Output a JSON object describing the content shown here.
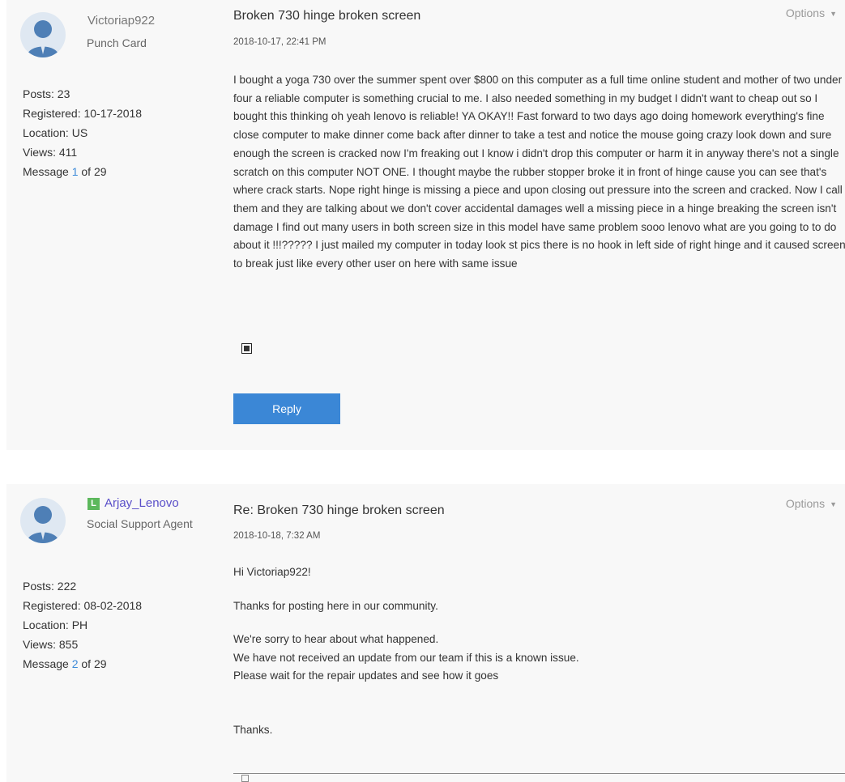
{
  "posts": [
    {
      "author": "Victoriap922",
      "role": "Punch Card",
      "stats": {
        "posts_label": "Posts:",
        "posts": "23",
        "registered_label": "Registered:",
        "registered": "10-17-2018",
        "location_label": "Location:",
        "location": "US",
        "views_label": "Views:",
        "views": "411",
        "message_prefix": "Message",
        "message_num": "1",
        "message_suffix": "of 29"
      },
      "title": "Broken 730 hinge broken screen",
      "date": "2018-10-17, 22:41 PM",
      "options_label": "Options",
      "body": [
        "I bought a yoga 730 over the summer spent over $800 on this computer as a full time online student and mother of two under four a reliable computer is something crucial to me. I also needed something in my budget I didn't want to cheap out so I bought this thinking oh yeah lenovo is reliable! YA OKAY!! Fast forward to two days ago doing homework everything's fine close computer to make dinner come back after dinner to take a test and notice the mouse going crazy look down and sure enough the screen is cracked now I'm freaking out I know i didn't drop this computer or harm it in anyway there's not a single scratch on this computer NOT ONE. I thought maybe the rubber stopper broke it in front of hinge cause you can see that's where crack starts. Nope right hinge is missing a piece and upon closing out pressure into the screen and cracked. Now I call them and they are talking about we don't cover accidental damages well a missing piece in a hinge breaking the screen isn't damage I find out many users in both screen size in this model have same problem sooo lenovo what are you going to to do about it !!!????? I just mailed my computer in today look st pics there is no hook in left side of right hinge and it caused screen to break just like every other user on here with same issue"
      ],
      "reply_label": "Reply"
    },
    {
      "rank_badge": "L",
      "author": "Arjay_Lenovo",
      "role": "Social Support Agent",
      "stats": {
        "posts_label": "Posts:",
        "posts": "222",
        "registered_label": "Registered:",
        "registered": "08-02-2018",
        "location_label": "Location:",
        "location": "PH",
        "views_label": "Views:",
        "views": "855",
        "message_prefix": "Message",
        "message_num": "2",
        "message_suffix": "of 29"
      },
      "title": "Re: Broken 730 hinge broken screen",
      "date": "2018-10-18, 7:32 AM",
      "options_label": "Options",
      "body": [
        "Hi Victoriap922!",
        "Thanks for posting here in our community.",
        "We're sorry to hear about what happened.",
        "We have not received an update from our team if this is a known issue.",
        "Please wait for the repair updates and see how it goes",
        "Thanks."
      ]
    }
  ],
  "colors": {
    "accent": "#3b87d6",
    "link": "#3d8bd9",
    "agent_name": "#5a4fc9",
    "badge": "#5cb85c",
    "post_bg": "#f8f8f8"
  }
}
